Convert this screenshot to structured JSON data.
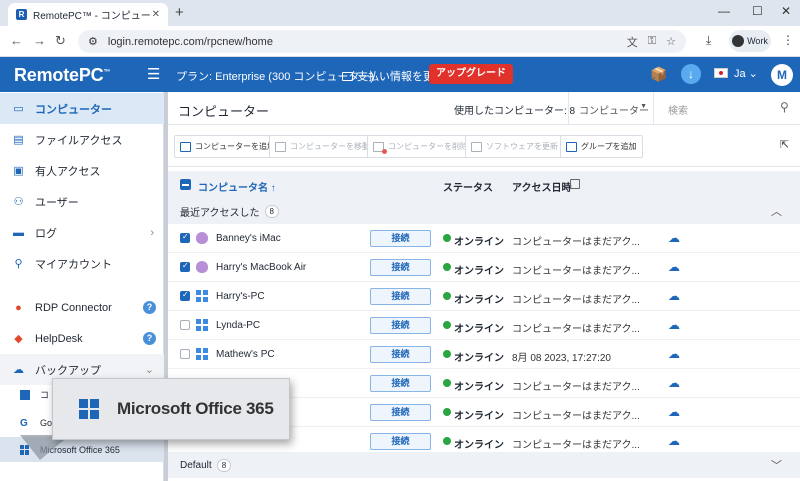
{
  "browser": {
    "tab_title": "RemotePC™ - コンピューター",
    "url": "login.remotepc.com/rpcnew/home",
    "profile_label": "Work"
  },
  "header": {
    "logo": "RemotePC",
    "plan": "プラン: Enterprise (300 コンピューター)",
    "billing": "支払い情報を更新",
    "upgrade": "アップグレード",
    "lang": "Ja",
    "avatar_initial": "M"
  },
  "sidebar": {
    "items": [
      {
        "label": "コンピューター"
      },
      {
        "label": "ファイルアクセス"
      },
      {
        "label": "有人アクセス"
      },
      {
        "label": "ユーザー"
      },
      {
        "label": "ログ"
      },
      {
        "label": "マイアカウント"
      },
      {
        "label": "RDP Connector"
      },
      {
        "label": "HelpDesk"
      },
      {
        "label": "バックアップ"
      }
    ],
    "sub_items": [
      {
        "label": "コ"
      },
      {
        "label": "Go"
      },
      {
        "label": "Microsoft Office 365"
      }
    ]
  },
  "main": {
    "title": "コンピューター",
    "used": "使用したコンピューター: 8",
    "select": "コンピューター",
    "search_placeholder": "検索",
    "toolbar": [
      {
        "label": "コンピューターを追加"
      },
      {
        "label": "コンピューターを移動"
      },
      {
        "label": "コンピューターを削除"
      },
      {
        "label": "ソフトウェアを更新"
      },
      {
        "label": "グループを追加"
      }
    ],
    "columns": {
      "name": "コンピュータ名 ↑",
      "status": "ステータス",
      "access": "アクセス日時"
    },
    "group_recent": {
      "label": "最近アクセスした",
      "count": "8"
    },
    "group_default": {
      "label": "Default",
      "count": "8"
    },
    "rows": [
      {
        "name": "Banney's iMac",
        "connect": "接続",
        "status": "オンライン",
        "access": "コンピューターはまだアク..."
      },
      {
        "name": "Harry's MacBook Air",
        "connect": "接続",
        "status": "オンライン",
        "access": "コンピューターはまだアク..."
      },
      {
        "name": "Harry's-PC",
        "connect": "接続",
        "status": "オンライン",
        "access": "コンピューターはまだアク..."
      },
      {
        "name": "Lynda-PC",
        "connect": "接続",
        "status": "オンライン",
        "access": "コンピューターはまだアク..."
      },
      {
        "name": "Mathew's PC",
        "connect": "接続",
        "status": "オンライン",
        "access": "8月 08 2023, 17:27:20"
      },
      {
        "name": "",
        "connect": "接続",
        "status": "オンライン",
        "access": "コンピューターはまだアク..."
      },
      {
        "name": "",
        "connect": "接続",
        "status": "オンライン",
        "access": "コンピューターはまだアク..."
      },
      {
        "name": "",
        "connect": "接続",
        "status": "オンライン",
        "access": "コンピューターはまだアク..."
      }
    ]
  },
  "callout": {
    "label": "Microsoft Office 365"
  }
}
